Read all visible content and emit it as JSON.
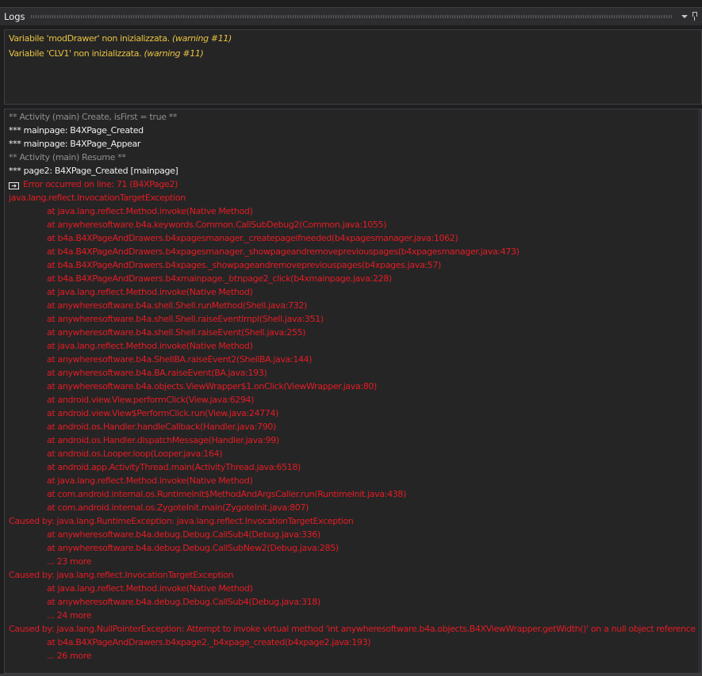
{
  "header": {
    "title": "Logs",
    "dropdown_icon": "chevron-down-icon",
    "pin_icon": "pin-icon"
  },
  "colors": {
    "warning": "#e8c340",
    "error": "#e51c23",
    "info": "#8f8f8f",
    "normal": "#f0f0f0",
    "background": "#252526"
  },
  "warnings": [
    {
      "text": "Variabile 'modDrawer' non inizializzata.",
      "note": "(warning #11)"
    },
    {
      "text": "Variabile 'CLV1' non inizializzata.",
      "note": "(warning #11)"
    }
  ],
  "log": [
    {
      "kind": "gray",
      "indent": false,
      "text": "** Activity (main) Create, isFirst = true **"
    },
    {
      "kind": "white",
      "indent": false,
      "text": "*** mainpage: B4XPage_Created"
    },
    {
      "kind": "white",
      "indent": false,
      "text": "*** mainpage: B4XPage_Appear"
    },
    {
      "kind": "gray",
      "indent": false,
      "text": "** Activity (main) Resume **"
    },
    {
      "kind": "white",
      "indent": false,
      "text": "*** page2: B4XPage_Created [mainpage]"
    },
    {
      "kind": "red",
      "indent": false,
      "link": true,
      "text": "Error occurred on line: 71 (B4XPage2)"
    },
    {
      "kind": "red",
      "indent": false,
      "text": "java.lang.reflect.InvocationTargetException"
    },
    {
      "kind": "red",
      "indent": true,
      "text": "at java.lang.reflect.Method.invoke(Native Method)"
    },
    {
      "kind": "red",
      "indent": true,
      "text": "at anywheresoftware.b4a.keywords.Common.CallSubDebug2(Common.java:1055)"
    },
    {
      "kind": "red",
      "indent": true,
      "text": "at b4a.B4XPageAndDrawers.b4xpagesmanager._createpageifneeded(b4xpagesmanager.java:1062)"
    },
    {
      "kind": "red",
      "indent": true,
      "text": "at b4a.B4XPageAndDrawers.b4xpagesmanager._showpageandremovepreviouspages(b4xpagesmanager.java:473)"
    },
    {
      "kind": "red",
      "indent": true,
      "text": "at b4a.B4XPageAndDrawers.b4xpages._showpageandremovepreviouspages(b4xpages.java:57)"
    },
    {
      "kind": "red",
      "indent": true,
      "text": "at b4a.B4XPageAndDrawers.b4xmainpage._btnpage2_click(b4xmainpage.java:228)"
    },
    {
      "kind": "red",
      "indent": true,
      "text": "at java.lang.reflect.Method.invoke(Native Method)"
    },
    {
      "kind": "red",
      "indent": true,
      "text": "at anywheresoftware.b4a.shell.Shell.runMethod(Shell.java:732)"
    },
    {
      "kind": "red",
      "indent": true,
      "text": "at anywheresoftware.b4a.shell.Shell.raiseEventImpl(Shell.java:351)"
    },
    {
      "kind": "red",
      "indent": true,
      "text": "at anywheresoftware.b4a.shell.Shell.raiseEvent(Shell.java:255)"
    },
    {
      "kind": "red",
      "indent": true,
      "text": "at java.lang.reflect.Method.invoke(Native Method)"
    },
    {
      "kind": "red",
      "indent": true,
      "text": "at anywheresoftware.b4a.ShellBA.raiseEvent2(ShellBA.java:144)"
    },
    {
      "kind": "red",
      "indent": true,
      "text": "at anywheresoftware.b4a.BA.raiseEvent(BA.java:193)"
    },
    {
      "kind": "red",
      "indent": true,
      "text": "at anywheresoftware.b4a.objects.ViewWrapper$1.onClick(ViewWrapper.java:80)"
    },
    {
      "kind": "red",
      "indent": true,
      "text": "at android.view.View.performClick(View.java:6294)"
    },
    {
      "kind": "red",
      "indent": true,
      "text": "at android.view.View$PerformClick.run(View.java:24774)"
    },
    {
      "kind": "red",
      "indent": true,
      "text": "at android.os.Handler.handleCallback(Handler.java:790)"
    },
    {
      "kind": "red",
      "indent": true,
      "text": "at android.os.Handler.dispatchMessage(Handler.java:99)"
    },
    {
      "kind": "red",
      "indent": true,
      "text": "at android.os.Looper.loop(Looper.java:164)"
    },
    {
      "kind": "red",
      "indent": true,
      "text": "at android.app.ActivityThread.main(ActivityThread.java:6518)"
    },
    {
      "kind": "red",
      "indent": true,
      "text": "at java.lang.reflect.Method.invoke(Native Method)"
    },
    {
      "kind": "red",
      "indent": true,
      "text": "at com.android.internal.os.RuntimeInit$MethodAndArgsCaller.run(RuntimeInit.java:438)"
    },
    {
      "kind": "red",
      "indent": true,
      "text": "at com.android.internal.os.ZygoteInit.main(ZygoteInit.java:807)"
    },
    {
      "kind": "red",
      "indent": false,
      "text": "Caused by: java.lang.RuntimeException: java.lang.reflect.InvocationTargetException"
    },
    {
      "kind": "red",
      "indent": true,
      "text": "at anywheresoftware.b4a.debug.Debug.CallSub4(Debug.java:336)"
    },
    {
      "kind": "red",
      "indent": true,
      "text": "at anywheresoftware.b4a.debug.Debug.CallSubNew2(Debug.java:285)"
    },
    {
      "kind": "red",
      "indent": true,
      "text": "... 23 more"
    },
    {
      "kind": "red",
      "indent": false,
      "text": "Caused by: java.lang.reflect.InvocationTargetException"
    },
    {
      "kind": "red",
      "indent": true,
      "text": "at java.lang.reflect.Method.invoke(Native Method)"
    },
    {
      "kind": "red",
      "indent": true,
      "text": "at anywheresoftware.b4a.debug.Debug.CallSub4(Debug.java:318)"
    },
    {
      "kind": "red",
      "indent": true,
      "text": "... 24 more"
    },
    {
      "kind": "red",
      "indent": false,
      "text": "Caused by: java.lang.NullPointerException: Attempt to invoke virtual method 'int anywheresoftware.b4a.objects.B4XViewWrapper.getWidth()' on a null object reference"
    },
    {
      "kind": "red",
      "indent": true,
      "text": "at b4a.B4XPageAndDrawers.b4xpage2._b4xpage_created(b4xpage2.java:193)"
    },
    {
      "kind": "red",
      "indent": true,
      "text": "... 26 more"
    }
  ]
}
